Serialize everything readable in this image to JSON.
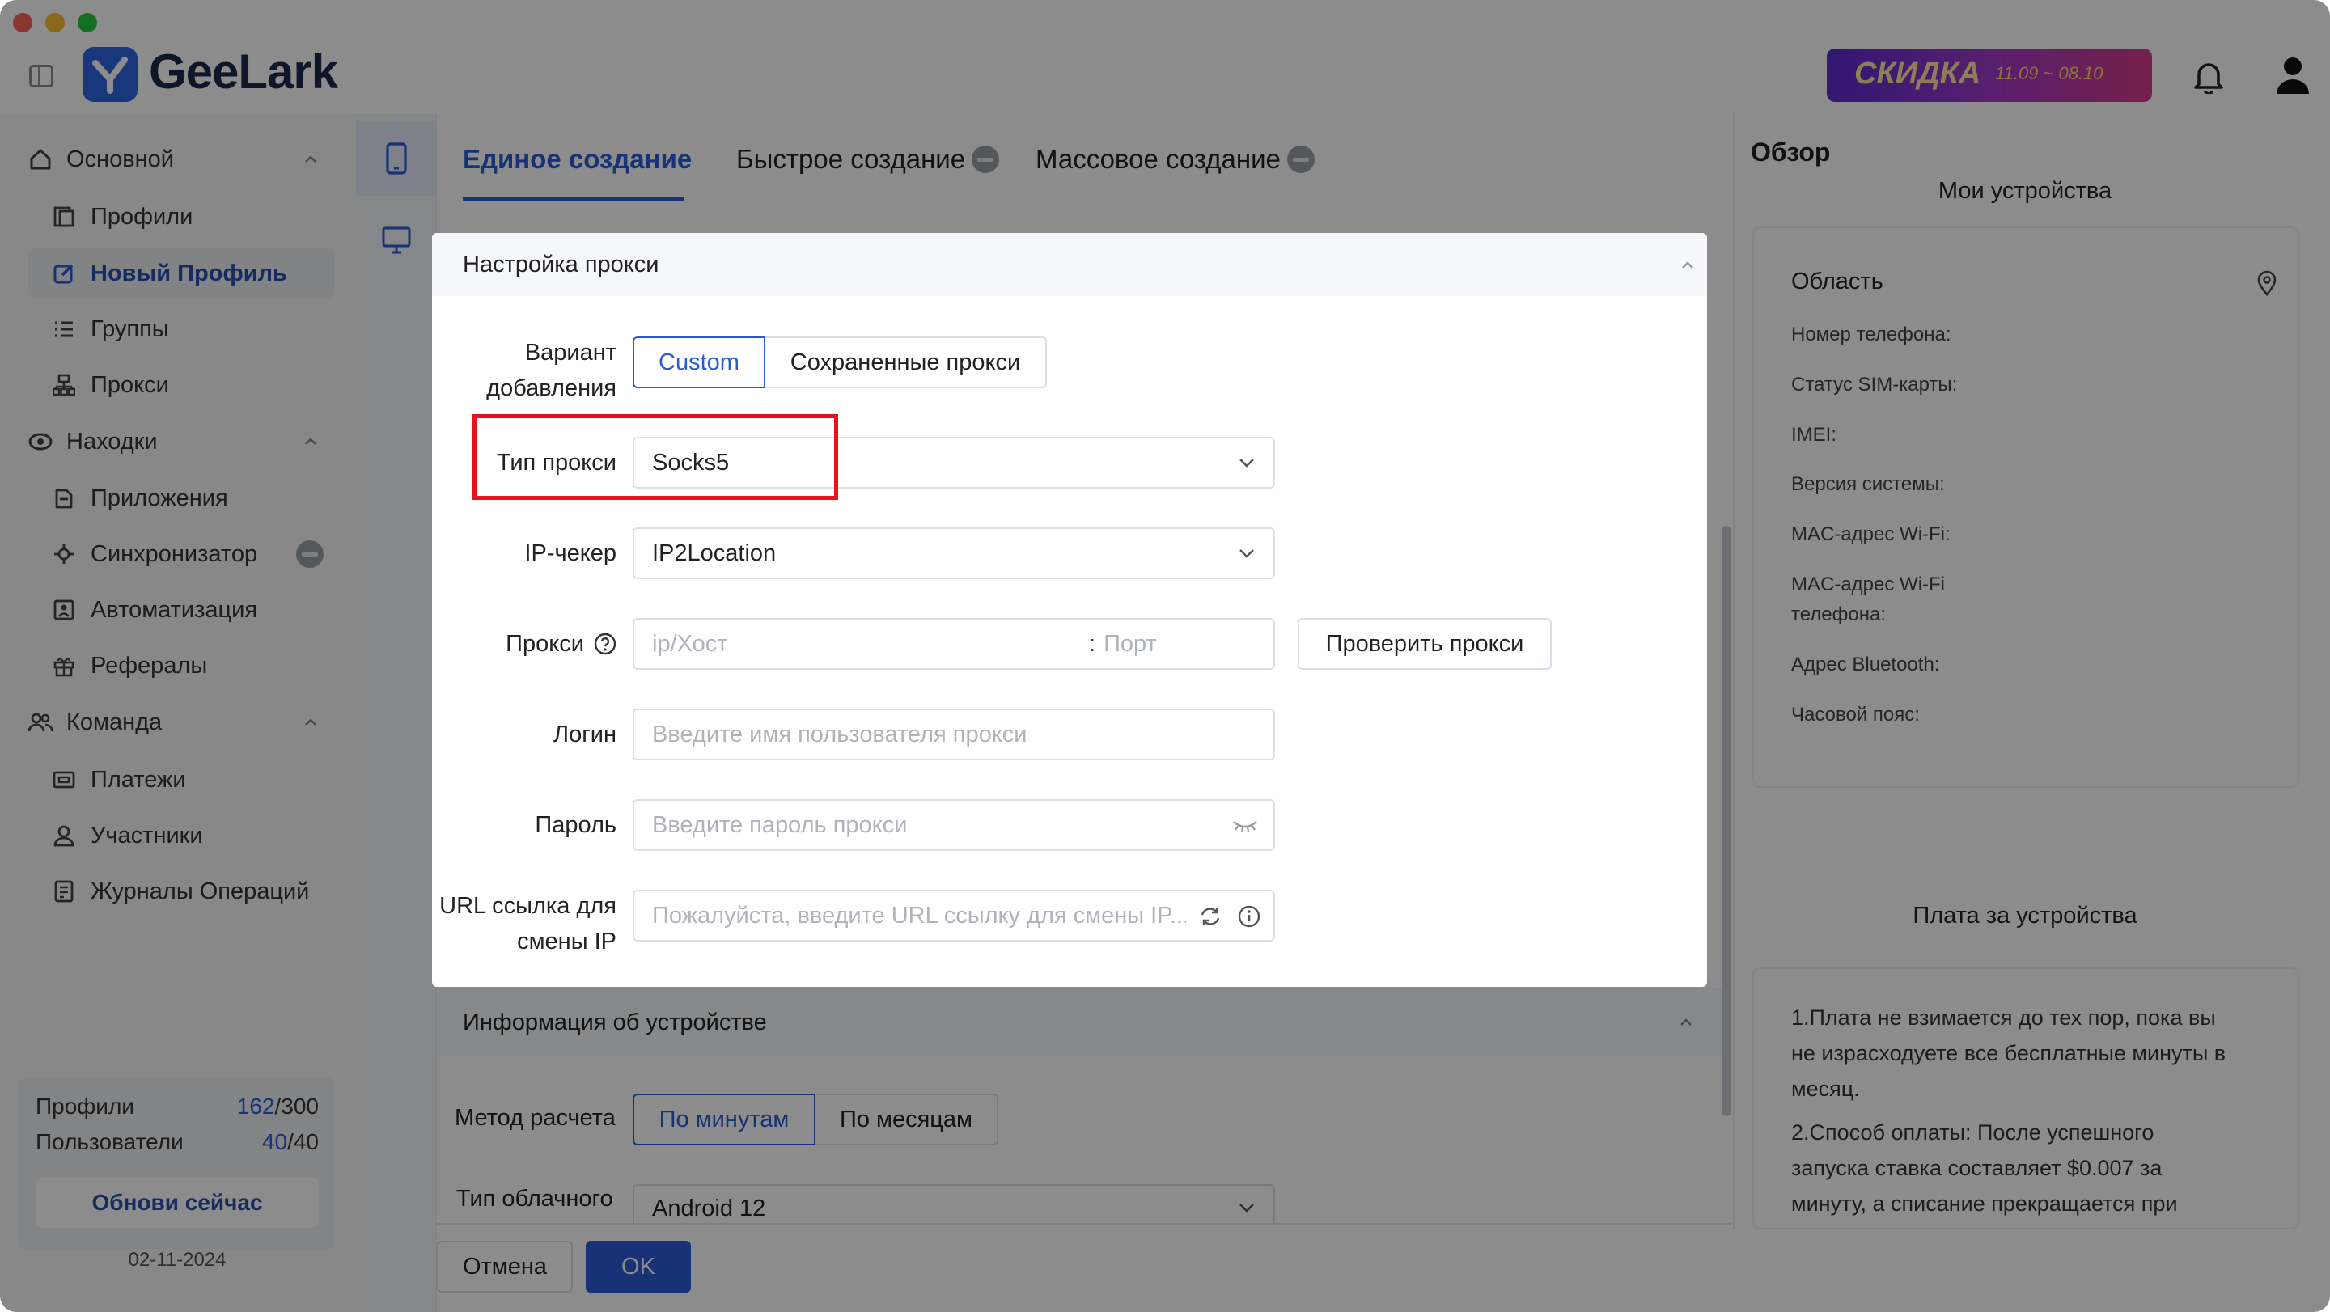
{
  "app": {
    "name": "GeeLark",
    "promo_text": "СКИДКА",
    "promo_dates": "11.09 ~ 08.10"
  },
  "sidebar": {
    "sections": [
      {
        "label": "Основной",
        "items": [
          "Профили",
          "Новый Профиль",
          "Группы",
          "Прокси"
        ]
      },
      {
        "label": "Находки",
        "items": [
          "Приложения",
          "Синхронизатор",
          "Автоматизация",
          "Рефералы"
        ]
      },
      {
        "label": "Команда",
        "items": [
          "Платежи",
          "Участники",
          "Журналы Операций"
        ]
      }
    ],
    "active_item": "Новый Профиль",
    "stats": {
      "profiles_label": "Профили",
      "profiles_used": "162",
      "profiles_total": "/300",
      "users_label": "Пользователи",
      "users_used": "40",
      "users_total": "/40"
    },
    "upgrade_button": "Обнови сейчас",
    "date": "02-11-2024"
  },
  "tabs": [
    "Единое создание",
    "Быстрое создание",
    "Массовое создание"
  ],
  "proxy_dialog": {
    "title": "Настройка прокси",
    "add_variant_label_1": "Вариант",
    "add_variant_label_2": "добавления",
    "add_variant_options": [
      "Custom",
      "Сохраненные прокси"
    ],
    "proxy_type_label": "Тип прокси",
    "proxy_type_value": "Socks5",
    "ip_checker_label": "IP-чекер",
    "ip_checker_value": "IP2Location",
    "proxy_label": "Прокси",
    "host_placeholder": "ip/Хост",
    "port_separator": ":",
    "port_placeholder": "Порт",
    "check_button": "Проверить прокси",
    "login_label": "Логин",
    "login_placeholder": "Введите имя пользователя прокси",
    "password_label": "Пароль",
    "password_placeholder": "Введите пароль прокси",
    "url_label_1": "URL ссылка для",
    "url_label_2": "смены IP",
    "url_placeholder": "Пожалуйста, введите URL ссылку для смены IP..."
  },
  "device_section": {
    "title": "Информация об устройстве",
    "billing_label": "Метод расчета",
    "billing_options": [
      "По минутам",
      "По месяцам"
    ],
    "cloud_type_label": "Тип облачного",
    "cloud_type_value": "Android 12"
  },
  "footer": {
    "cancel": "Отмена",
    "ok": "OK"
  },
  "overview": {
    "title": "Обзор",
    "subtitle": "Мои устройства",
    "region_label": "Область",
    "rows": [
      "Номер телефона:",
      "Статус SIM-карты:",
      "IMEI:",
      "Версия системы:",
      "MAC-адрес Wi-Fi:",
      "MAC-адрес Wi-Fi",
      "телефона:",
      "Адрес Bluetooth:",
      "Часовой пояс:"
    ],
    "fee_title": "Плата за устройства",
    "fee_lines": [
      "1.Плата не взимается до тех пор, пока вы",
      "не израсходуете все бесплатные минуты в",
      "месяц.",
      "2.Способ оплаты: После успешного",
      "запуска ставка составляет $0.007 за",
      "минуту, а списание прекращается при"
    ]
  },
  "colors": {
    "accent": "#2a5bd7",
    "highlight": "#e8141b",
    "overlay": "rgba(0,0,0,0.45)"
  }
}
